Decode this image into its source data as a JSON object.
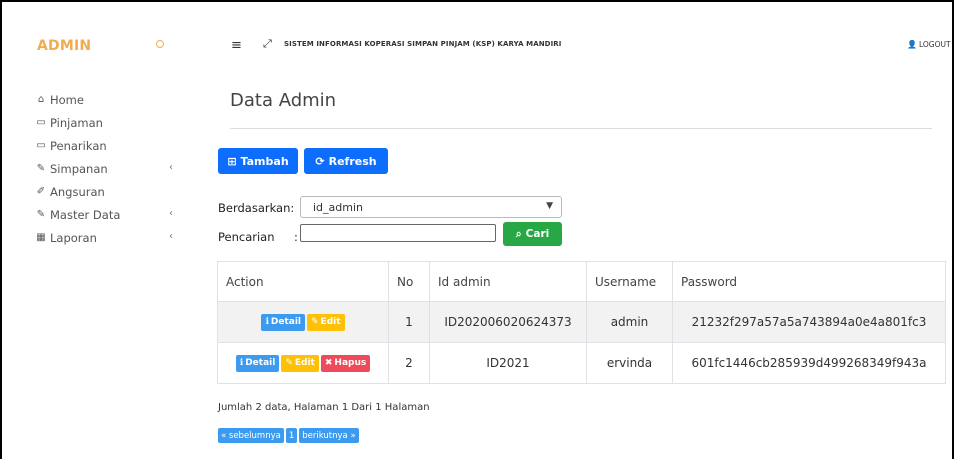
{
  "sidebar": {
    "brand": "ADMIN",
    "items": [
      {
        "icon": "home-icon",
        "glyph": "⌂",
        "label": "Home",
        "has_children": false
      },
      {
        "icon": "credit-card-icon",
        "glyph": "▭",
        "label": "Pinjaman",
        "has_children": false
      },
      {
        "icon": "credit-card-icon",
        "glyph": "▭",
        "label": "Penarikan",
        "has_children": false
      },
      {
        "icon": "edit-icon",
        "glyph": "✎",
        "label": "Simpanan",
        "has_children": true
      },
      {
        "icon": "pencil-icon",
        "glyph": "✐",
        "label": "Angsuran",
        "has_children": false
      },
      {
        "icon": "edit-icon",
        "glyph": "✎",
        "label": "Master Data",
        "has_children": true
      },
      {
        "icon": "calendar-icon",
        "glyph": "▦",
        "label": "Laporan",
        "has_children": true
      }
    ]
  },
  "header": {
    "title": "SISTEM INFORMASI KOPERASI SIMPAN PINJAM (KSP) KARYA MANDIRI",
    "logout_label": "LOGOUT"
  },
  "page": {
    "title": "Data Admin"
  },
  "toolbar": {
    "tambah_label": "Tambah",
    "refresh_label": "Refresh"
  },
  "filter": {
    "by_label": "Berdasarkan:",
    "by_value": "id_admin",
    "search_label": "Pencarian",
    "search_colon": ":",
    "search_value": "",
    "cari_label": "Cari"
  },
  "table": {
    "headers": [
      "Action",
      "No",
      "Id admin",
      "Username",
      "Password"
    ],
    "rows": [
      {
        "no": "1",
        "id_admin": "ID202006020624373",
        "username": "admin",
        "password": "21232f297a57a5a743894a0e4a801fc3",
        "actions": [
          "Detail",
          "Edit"
        ]
      },
      {
        "no": "2",
        "id_admin": "ID2021",
        "username": "ervinda",
        "password": "601fc1446cb285939d499268349f943a",
        "actions": [
          "Detail",
          "Edit",
          "Hapus"
        ]
      }
    ]
  },
  "footer": {
    "summary": "Jumlah 2 data, Halaman 1 Dari 1 Halaman",
    "prev_label": "« sebelumnya",
    "page_label": "1",
    "next_label": "berikutnya »"
  },
  "colors": {
    "brand": "#f0ad4e",
    "primary": "#0d6efd",
    "success": "#28a745",
    "info": "#3c9bef",
    "warning": "#ffc107",
    "danger": "#ef4a5b"
  }
}
